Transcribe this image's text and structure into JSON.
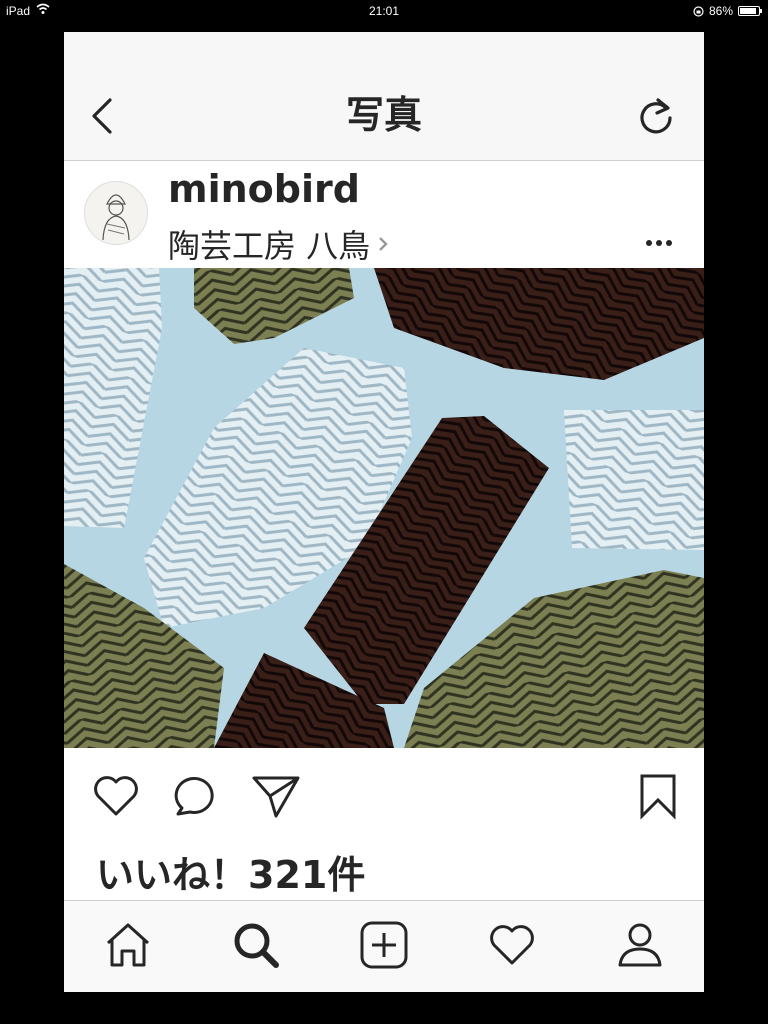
{
  "status_bar": {
    "device": "iPad",
    "time": "21:01",
    "battery": "86%",
    "battery_level": 0.86
  },
  "nav": {
    "title": "写真",
    "back_icon": "chevron-left-icon",
    "refresh_icon": "refresh-icon"
  },
  "post": {
    "username": "minobird",
    "location": "陶芸工房 八鳥",
    "likes": "いいね！321件"
  },
  "actions": [
    "heart-icon",
    "comment-icon",
    "share-icon",
    "bookmark-icon"
  ],
  "tabs": [
    "home-icon",
    "search-icon",
    "add-icon",
    "activity-icon",
    "profile-icon"
  ],
  "colors": {
    "text": "#262626",
    "bar_bg": "#f7f7f7",
    "photo_bg": "#b9d8e6",
    "white_glaze": "#e9f3f7",
    "green_glaze": "#6f7448",
    "dark_glaze": "#3a1c14"
  }
}
